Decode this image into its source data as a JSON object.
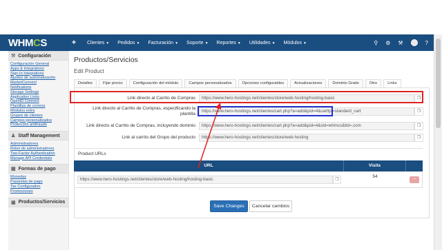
{
  "brand": {
    "text_a": "WHM",
    "text_o": "C",
    "text_b": "S",
    "accent": "#8cc63f",
    "nav_bg": "#1a4d80"
  },
  "nav": {
    "plus_icon": "plus",
    "items": [
      "Clientes",
      "Pedidos",
      "Facturación",
      "Soporte",
      "Reportes",
      "Utilidades",
      "Módulos"
    ],
    "right_icons": [
      "search-icon",
      "wrench-icon",
      "settings-icon",
      "user-avatar",
      "help-icon"
    ]
  },
  "sidebar": {
    "sections": [
      {
        "title": "Configuración",
        "icon": "wrench-icon",
        "links": [
          "Configuración General",
          "Apps & Integrations",
          "Sign-In Integrations",
          "Ajustes de automatización",
          "MarketConnect",
          "Notifications",
          "Storage Settings",
          "Application Links",
          "OpenID Connect",
          "Plantillas de correos",
          "Módulos extra",
          "Grupos de clientes",
          "Campos personalizados",
          "Protección antifraude"
        ]
      },
      {
        "title": "Staff Management",
        "icon": "users-icon",
        "links": [
          "Administradores",
          "Roles de administradores",
          "Two-Factor Authentication",
          "Manage API Credentials"
        ]
      },
      {
        "title": "Formas de pago",
        "icon": "credit-card-icon",
        "links": [
          "Monedas",
          "Pasarelas de pago",
          "Tax Configuration",
          "Promociones"
        ]
      },
      {
        "title": "Productos/Servicios",
        "icon": "cube-icon",
        "links": []
      }
    ]
  },
  "main": {
    "title": "Productos/Servicios",
    "subtitle": "Edit Product",
    "tabs": [
      "Detalles",
      "Fijar precio",
      "Configuración del módulo",
      "Campos personalizados",
      "Opciones configurables",
      "Actualizaciones",
      "Dominio Gratis",
      "Otro",
      "Links"
    ],
    "active_tab": "Links",
    "links": [
      {
        "label": "Link directo al Carrito de Compras",
        "value": "https://www.hero-hostings.net/clientes/store/web-hosting/hosting-basic"
      },
      {
        "label": "Link directo al Carrito de Compras, especificando la plantilla",
        "value": "https://www.hero-hostings.net/clientes/cart.php?a=add&pid=4&carttpl=standard_cart"
      },
      {
        "label": "Link directo al Carrito de Compras, incluyendo dominio",
        "value": "https://www.hero-hostings.net/clientes/cart.php?a=add&pid=4&sld=whmcs&tld=.com"
      },
      {
        "label": "Link al carrito del Grupo del producto",
        "value": "https://www.hero-hostings.net/clientes/store/web-hosting"
      }
    ],
    "product_urls": {
      "title": "Product URLs",
      "col_url": "URL",
      "col_visits": "Visits",
      "rows": [
        {
          "url": "https://www.hero-hostings.net/clientes/store/web-hosting/hosting-basic",
          "visits": "54"
        }
      ]
    },
    "save_label": "Save Changes",
    "cancel_label": "Cancelar cambios"
  },
  "annotations": {
    "highlight_red": "#e02020",
    "highlight_blue": "#1e2fd0"
  }
}
